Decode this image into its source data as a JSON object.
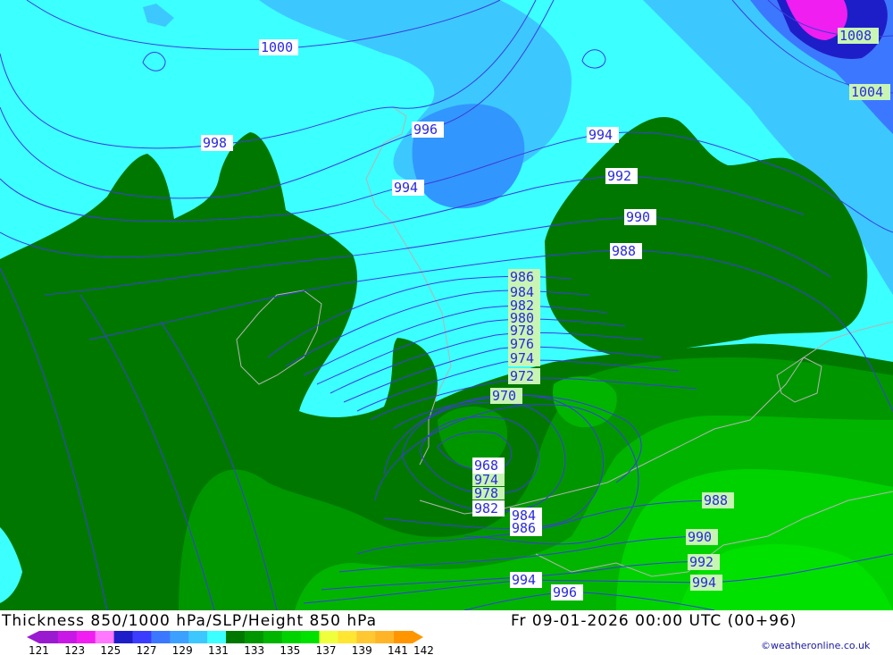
{
  "map": {
    "isobars": [
      {
        "value": "1000",
        "box": "white"
      },
      {
        "value": "998",
        "box": "white"
      },
      {
        "value": "996",
        "box": "white"
      },
      {
        "value": "994",
        "box": "white"
      },
      {
        "value": "994",
        "box": "white"
      },
      {
        "value": "992",
        "box": "white"
      },
      {
        "value": "990",
        "box": "white"
      },
      {
        "value": "988",
        "box": "white"
      },
      {
        "value": "986",
        "box": "green"
      },
      {
        "value": "984",
        "box": "green"
      },
      {
        "value": "982",
        "box": "green"
      },
      {
        "value": "980",
        "box": "green"
      },
      {
        "value": "978",
        "box": "green"
      },
      {
        "value": "976",
        "box": "green"
      },
      {
        "value": "974",
        "box": "green"
      },
      {
        "value": "972",
        "box": "green"
      },
      {
        "value": "970",
        "box": "green"
      },
      {
        "value": "968",
        "box": "white"
      },
      {
        "value": "974",
        "box": "green"
      },
      {
        "value": "978",
        "box": "green"
      },
      {
        "value": "982",
        "box": "white"
      },
      {
        "value": "984",
        "box": "white"
      },
      {
        "value": "986",
        "box": "white"
      },
      {
        "value": "988",
        "box": "green"
      },
      {
        "value": "990",
        "box": "green"
      },
      {
        "value": "992",
        "box": "green"
      },
      {
        "value": "994",
        "box": "green"
      },
      {
        "value": "994",
        "box": "white"
      },
      {
        "value": "996",
        "box": "white"
      },
      {
        "value": "1008",
        "box": "green"
      },
      {
        "value": "1004",
        "box": "green"
      }
    ],
    "colors": {
      "cyan": "#3cffff",
      "lightblue": "#3cc8ff",
      "blue": "#3296ff",
      "darkgreen": "#007800",
      "green2": "#009600",
      "green3": "#00b400",
      "green4": "#00d200",
      "green5": "#00e100",
      "isobar": "#3c3cdc",
      "coast": "#b4b4b4"
    }
  },
  "footer": {
    "title": "Thickness 850/1000 hPa/SLP/Height 850 hPa",
    "datetime": "Fr 09-01-2026 00:00 UTC (00+96)",
    "credit": "©weatheronline.co.uk"
  },
  "legend": {
    "ticks": [
      "121",
      "123",
      "125",
      "127",
      "129",
      "131",
      "133",
      "135",
      "137",
      "139",
      "141",
      "142"
    ],
    "swatches": [
      "#9a1ad0",
      "#c818e6",
      "#f01ef0",
      "#ff78ff",
      "#1e1ec8",
      "#3c3cff",
      "#3c78ff",
      "#3ca0ff",
      "#3cc8ff",
      "#3cffff",
      "#007800",
      "#009600",
      "#00b400",
      "#00d200",
      "#00e100",
      "#f0ff3c",
      "#ffe632",
      "#ffc832",
      "#ffb428",
      "#ff9600"
    ]
  }
}
